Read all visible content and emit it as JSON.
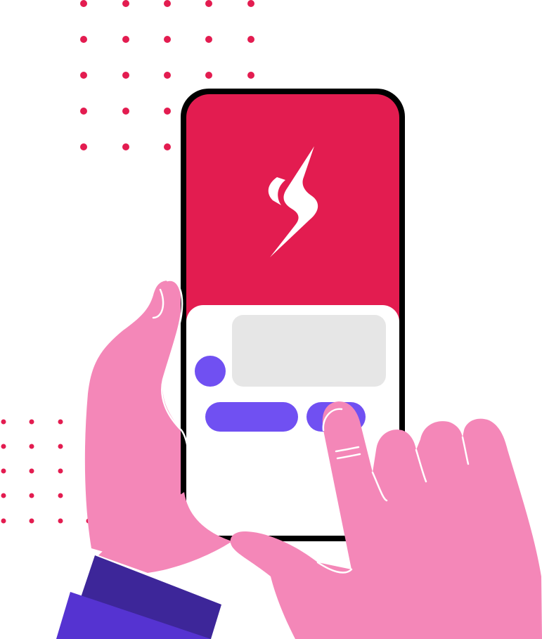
{
  "colors": {
    "background": "#ffffff",
    "brand_red": "#e31c50",
    "skin_pink": "#f487b8",
    "accent_purple": "#7050f2",
    "sleeve_dark": "#3d2699",
    "sleeve_light": "#5533d1",
    "card_white": "#ffffff",
    "placeholder_grey": "#e6e6e6",
    "phone_frame": "#000000"
  },
  "icons": {
    "logo": "lightning-bolt-logo"
  },
  "screen": {
    "placeholder_buttons": 2,
    "placeholder_avatar": 1,
    "placeholder_text_block": 1
  }
}
